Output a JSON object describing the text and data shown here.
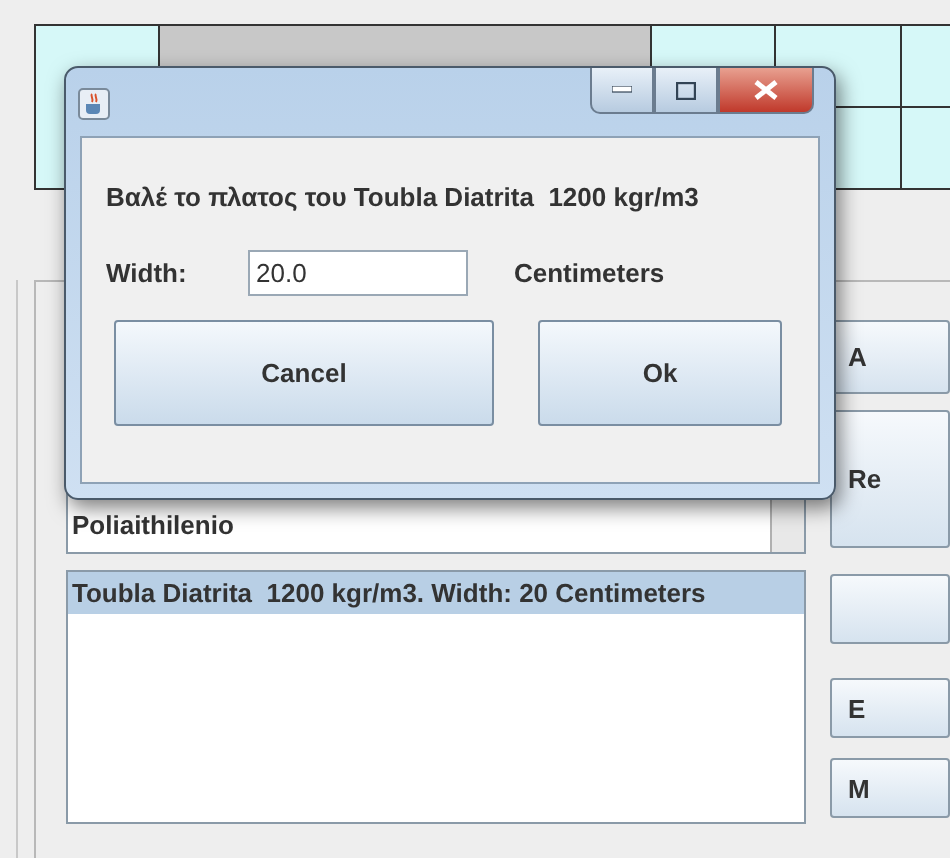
{
  "list_box": {
    "items": [
      "Poliaithilenio"
    ]
  },
  "selected_list": {
    "items": [
      {
        "text": "Toubla Diatrita  1200 kgr/m3. Width: 20 Centimeters",
        "selected": true
      }
    ]
  },
  "side_buttons": [
    {
      "kind": "text",
      "label": "A"
    },
    {
      "kind": "text",
      "label": "Re"
    },
    {
      "kind": "blank"
    },
    {
      "kind": "text",
      "label": "E"
    },
    {
      "kind": "text",
      "label": "M"
    }
  ],
  "dialog": {
    "prompt": "Βαλέ το πλατος του Toubla Diatrita  1200 kgr/m3",
    "width_label": "Width:",
    "width_value": "20.0",
    "unit": "Centimeters",
    "buttons": [
      "Cancel",
      "Ok"
    ]
  }
}
